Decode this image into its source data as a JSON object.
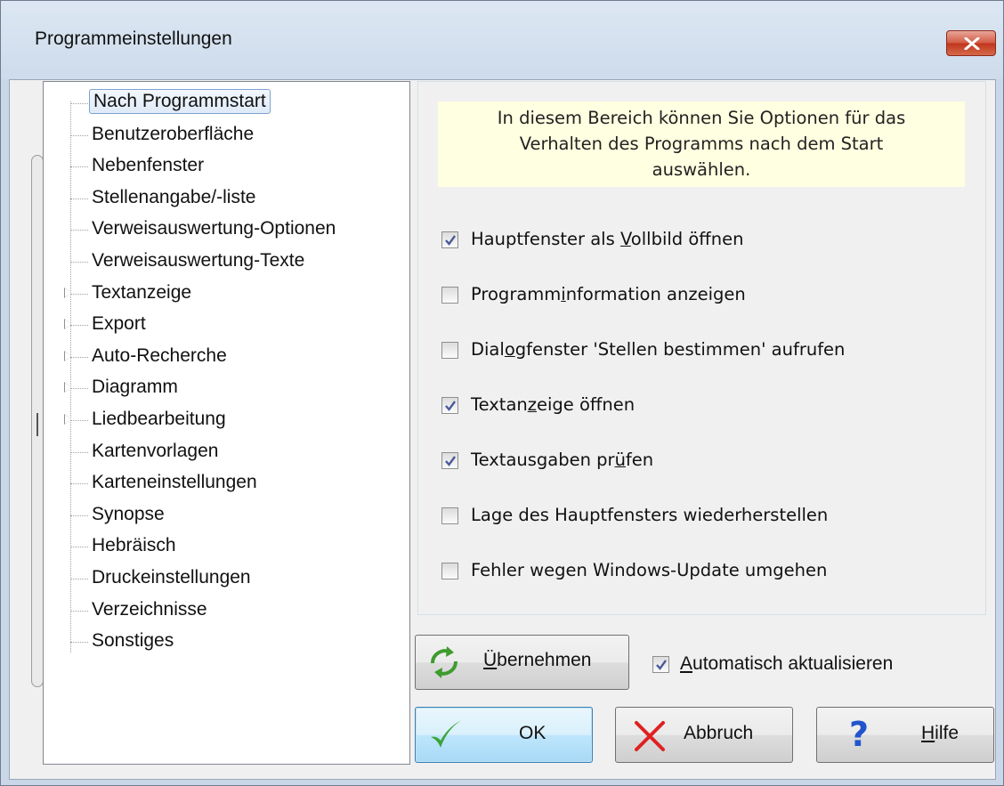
{
  "window": {
    "title": "Programmeinstellungen"
  },
  "tree": {
    "items": [
      {
        "label": "Nach Programmstart",
        "expandable": false,
        "selected": true
      },
      {
        "label": "Benutzeroberfläche",
        "expandable": false
      },
      {
        "label": "Nebenfenster",
        "expandable": false
      },
      {
        "label": "Stellenangabe/-liste",
        "expandable": false
      },
      {
        "label": "Verweisauswertung-Optionen",
        "expandable": false
      },
      {
        "label": "Verweisauswertung-Texte",
        "expandable": false
      },
      {
        "label": "Textanzeige",
        "expandable": true
      },
      {
        "label": "Export",
        "expandable": true
      },
      {
        "label": "Auto-Recherche",
        "expandable": true
      },
      {
        "label": "Diagramm",
        "expandable": true
      },
      {
        "label": "Liedbearbeitung",
        "expandable": true
      },
      {
        "label": "Kartenvorlagen",
        "expandable": false
      },
      {
        "label": "Karteneinstellungen",
        "expandable": false
      },
      {
        "label": "Synopse",
        "expandable": false
      },
      {
        "label": "Hebräisch",
        "expandable": false
      },
      {
        "label": "Druckeinstellungen",
        "expandable": false
      },
      {
        "label": "Verzeichnisse",
        "expandable": false
      },
      {
        "label": "Sonstiges",
        "expandable": false
      }
    ]
  },
  "panel": {
    "info_line1": "In diesem Bereich können Sie Optionen für das",
    "info_line2": "Verhalten des Programms nach dem Start",
    "info_line3": "auswählen.",
    "options": [
      {
        "pre": "Hauptfenster als ",
        "ul": "V",
        "post": "ollbild öffnen",
        "checked": true
      },
      {
        "pre": "Programm",
        "ul": "i",
        "post": "nformation anzeigen",
        "checked": false
      },
      {
        "pre": "Dial",
        "ul": "o",
        "post": "gfenster 'Stellen bestimmen' aufrufen",
        "checked": false
      },
      {
        "pre": "Textan",
        "ul": "z",
        "post": "eige öffnen",
        "checked": true
      },
      {
        "pre": "Textausgaben pr",
        "ul": "ü",
        "post": "fen",
        "checked": true
      },
      {
        "pre": "Lage des Hauptfensters wiederherstellen",
        "ul": "",
        "post": "",
        "checked": false
      },
      {
        "pre": "Fehler wegen Windows-Update umgehen",
        "ul": "",
        "post": "",
        "checked": false
      }
    ]
  },
  "buttons": {
    "apply": {
      "pre": "",
      "ul": "Ü",
      "mid": "b",
      "ul2": "",
      "post": "ernehmen",
      "full": "Übernehmen"
    },
    "ok": "OK",
    "cancel": "Abbruch",
    "help_ul": "H",
    "help_rest": "ilfe"
  },
  "auto_update": {
    "ul": "A",
    "rest": "utomatisch aktualisieren",
    "checked": true
  },
  "colors": {
    "check": "#4a5a9a",
    "ok_check": "#3aa33a",
    "cancel_x": "#e02020",
    "help_q": "#2255cc",
    "apply_arrows": "#3e9b2e"
  },
  "icons": {
    "close": "close-icon",
    "apply": "refresh-arrows-icon",
    "ok": "check-icon",
    "cancel": "x-icon",
    "help": "question-icon"
  }
}
